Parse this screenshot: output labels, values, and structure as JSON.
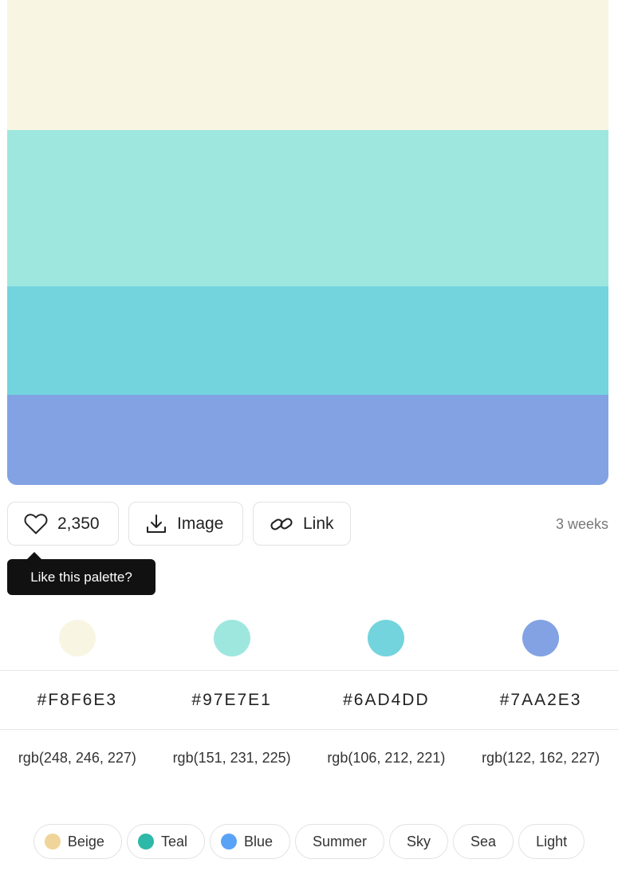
{
  "palette": {
    "colors": [
      {
        "hex": "#F8F6E3",
        "rgb": "rgb(248, 246, 227)",
        "swatch": "#F8F6E3"
      },
      {
        "hex": "#97E7E1",
        "rgb": "rgb(151, 231, 225)",
        "swatch": "#9EE7DF"
      },
      {
        "hex": "#6AD4DD",
        "rgb": "rgb(106, 212, 221)",
        "swatch": "#73D4DD"
      },
      {
        "hex": "#7AA2E3",
        "rgb": "rgb(122, 162, 227)",
        "swatch": "#82A2E3"
      }
    ]
  },
  "actions": {
    "like_count": "2,350",
    "like_icon": "heart-icon",
    "image_label": "Image",
    "image_icon": "download-icon",
    "link_label": "Link",
    "link_icon": "link-icon",
    "age": "3 weeks"
  },
  "tooltip": {
    "text": "Like this palette?"
  },
  "tags": [
    {
      "label": "Beige",
      "color": "#F0D499"
    },
    {
      "label": "Teal",
      "color": "#2EB8A8"
    },
    {
      "label": "Blue",
      "color": "#5AA2F5"
    },
    {
      "label": "Summer"
    },
    {
      "label": "Sky"
    },
    {
      "label": "Sea"
    },
    {
      "label": "Light"
    }
  ]
}
